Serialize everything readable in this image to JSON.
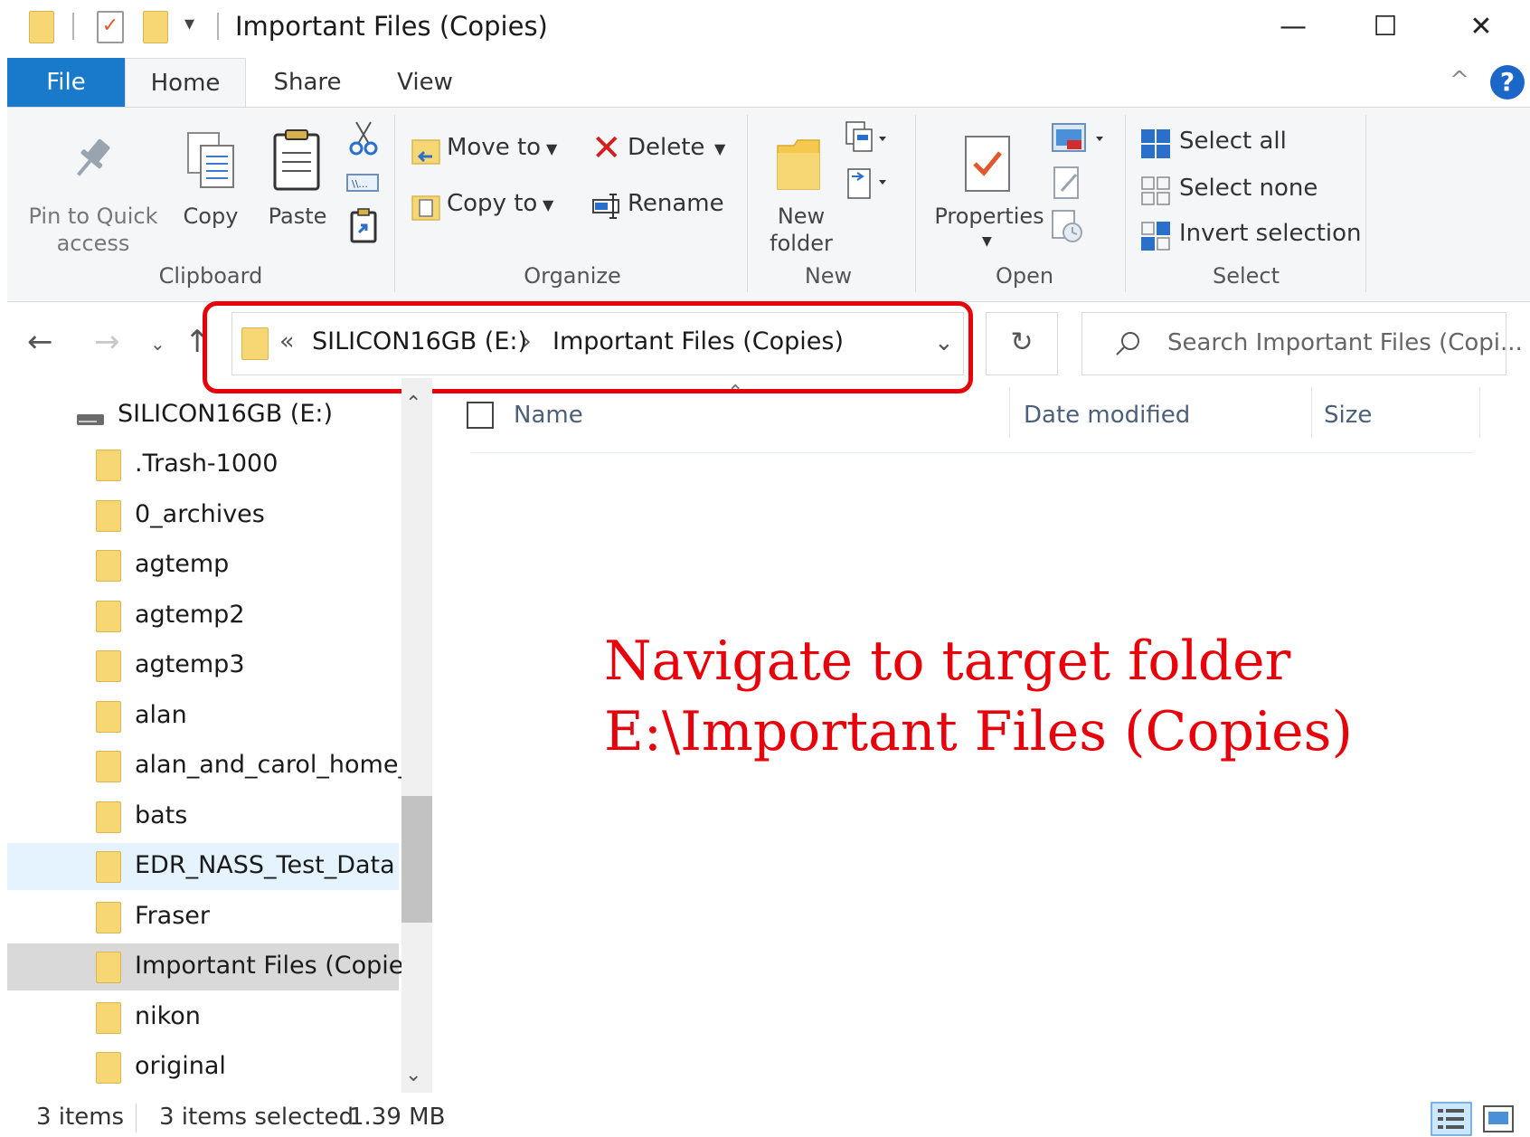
{
  "window": {
    "title": "Important Files (Copies)",
    "controls": {
      "minimize": "—",
      "maximize": "☐",
      "close": "✕"
    }
  },
  "ribbon": {
    "tabs": [
      "File",
      "Home",
      "Share",
      "View"
    ],
    "active_tab": "Home",
    "help": "?",
    "collapse": "^",
    "clipboard": {
      "group_label": "Clipboard",
      "pin_line1": "Pin to Quick",
      "pin_line2": "access",
      "copy": "Copy",
      "paste": "Paste"
    },
    "organize": {
      "group_label": "Organize",
      "move_to": "Move to",
      "copy_to": "Copy to",
      "delete": "Delete",
      "rename": "Rename"
    },
    "new": {
      "group_label": "New",
      "new_folder_line1": "New",
      "new_folder_line2": "folder"
    },
    "open": {
      "group_label": "Open",
      "properties": "Properties"
    },
    "select": {
      "group_label": "Select",
      "select_all": "Select all",
      "select_none": "Select none",
      "invert_selection": "Invert selection"
    }
  },
  "address": {
    "overflow": "«",
    "crumbs": [
      "SILICON16GB (E:)",
      "Important Files (Copies)"
    ],
    "separator": "›",
    "search_placeholder": "Search Important Files (Copi..."
  },
  "nav_tree": {
    "drive": "SILICON16GB (E:)",
    "folders": [
      ".Trash-1000",
      "0_archives",
      "agtemp",
      "agtemp2",
      "agtemp3",
      "alan",
      "alan_and_carol_home_p",
      "bats",
      "EDR_NASS_Test_Data",
      "Fraser",
      "Important Files (Copies)",
      "nikon",
      "original"
    ],
    "hover_index": 8,
    "selected_index": 10
  },
  "columns": [
    "Name",
    "Date modified",
    "Size"
  ],
  "annotation": {
    "line1": "Navigate to target folder",
    "line2": "E:\\Important Files (Copies)",
    "color": "#e8000b"
  },
  "status_bar": {
    "items": "3 items",
    "selection": "3 items selected",
    "size": "1.39 MB"
  }
}
